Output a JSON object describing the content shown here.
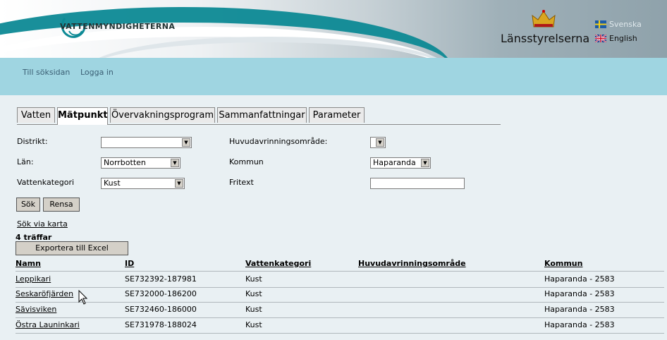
{
  "header": {
    "logo_text": "VATTENMYNDIGHETERNA",
    "agency": "Länsstyrelserna",
    "lang_swedish": "Svenska",
    "lang_english": "English"
  },
  "nav": {
    "search_page": "Till söksidan",
    "login": "Logga in"
  },
  "tabs": [
    "Vatten",
    "Mätpunkt",
    "Övervakningsprogram",
    "Sammanfattningar",
    "Parameter"
  ],
  "active_tab": "Mätpunkt",
  "form": {
    "distrikt_label": "Distrikt:",
    "distrikt_value": "",
    "lan_label": "Län:",
    "lan_value": "Norrbotten",
    "vattenkategori_label": "Vattenkategori",
    "vattenkategori_value": "Kust",
    "huvud_label": "Huvudavrinningsområde:",
    "huvud_value": "",
    "kommun_label": "Kommun",
    "kommun_value": "Haparanda",
    "fritext_label": "Fritext",
    "fritext_value": ""
  },
  "buttons": {
    "search": "Sök",
    "clear": "Rensa",
    "export": "Exportera till Excel"
  },
  "map_link": "Sök via karta",
  "hits": "4 träffar",
  "table": {
    "headers": [
      "Namn",
      "ID",
      "Vattenkategori",
      "Huvudavrinningsområde",
      "Kommun"
    ],
    "rows": [
      [
        "Leppikari",
        "SE732392-187981",
        "Kust",
        "",
        "Haparanda - 2583"
      ],
      [
        "Seskaröfjärden",
        "SE732000-186200",
        "Kust",
        "",
        "Haparanda - 2583"
      ],
      [
        "Sävisviken",
        "SE732460-186000",
        "Kust",
        "",
        "Haparanda - 2583"
      ],
      [
        "Östra Launinkari",
        "SE731978-188024",
        "Kust",
        "",
        "Haparanda - 2583"
      ]
    ]
  },
  "colors": {
    "nav_band": "#9fd5e1",
    "content_bg": "#e9f0f3",
    "button_bg": "#d4d0c8"
  }
}
